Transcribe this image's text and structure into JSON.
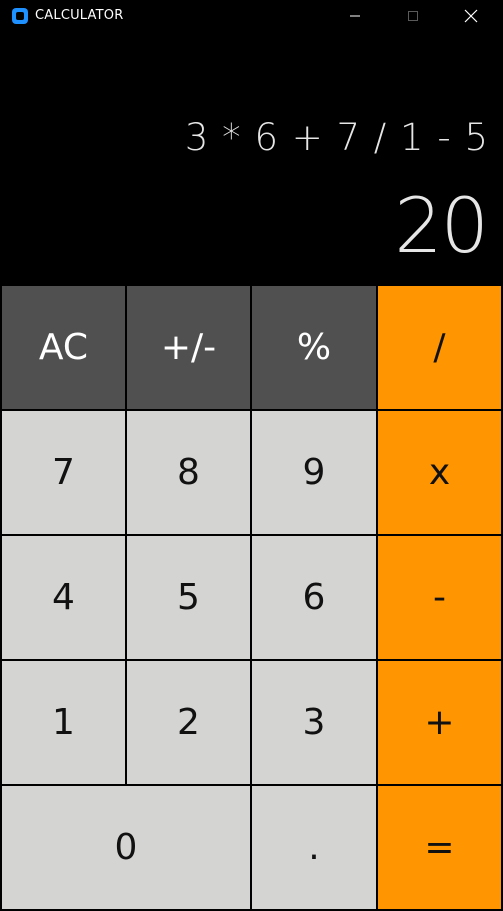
{
  "window": {
    "title": "CALCULATOR",
    "icon": "calculator-app-icon",
    "controls": [
      "minimize-icon",
      "maximize-icon",
      "close-icon"
    ]
  },
  "display": {
    "expression": "3 * 6 + 7 / 1 - 5",
    "result": "20"
  },
  "keys": {
    "ac": "AC",
    "sign": "+/-",
    "percent": "%",
    "divide": "/",
    "seven": "7",
    "eight": "8",
    "nine": "9",
    "multiply": "x",
    "four": "4",
    "five": "5",
    "six": "6",
    "subtract": "-",
    "one": "1",
    "two": "2",
    "three": "3",
    "add": "+",
    "zero": "0",
    "decimal": ".",
    "equals": "="
  },
  "colors": {
    "background": "#000000",
    "function_key": "#505050",
    "number_key": "#d4d4d2",
    "operator_key": "#ff9500",
    "display_text": "#e6e6e6"
  }
}
